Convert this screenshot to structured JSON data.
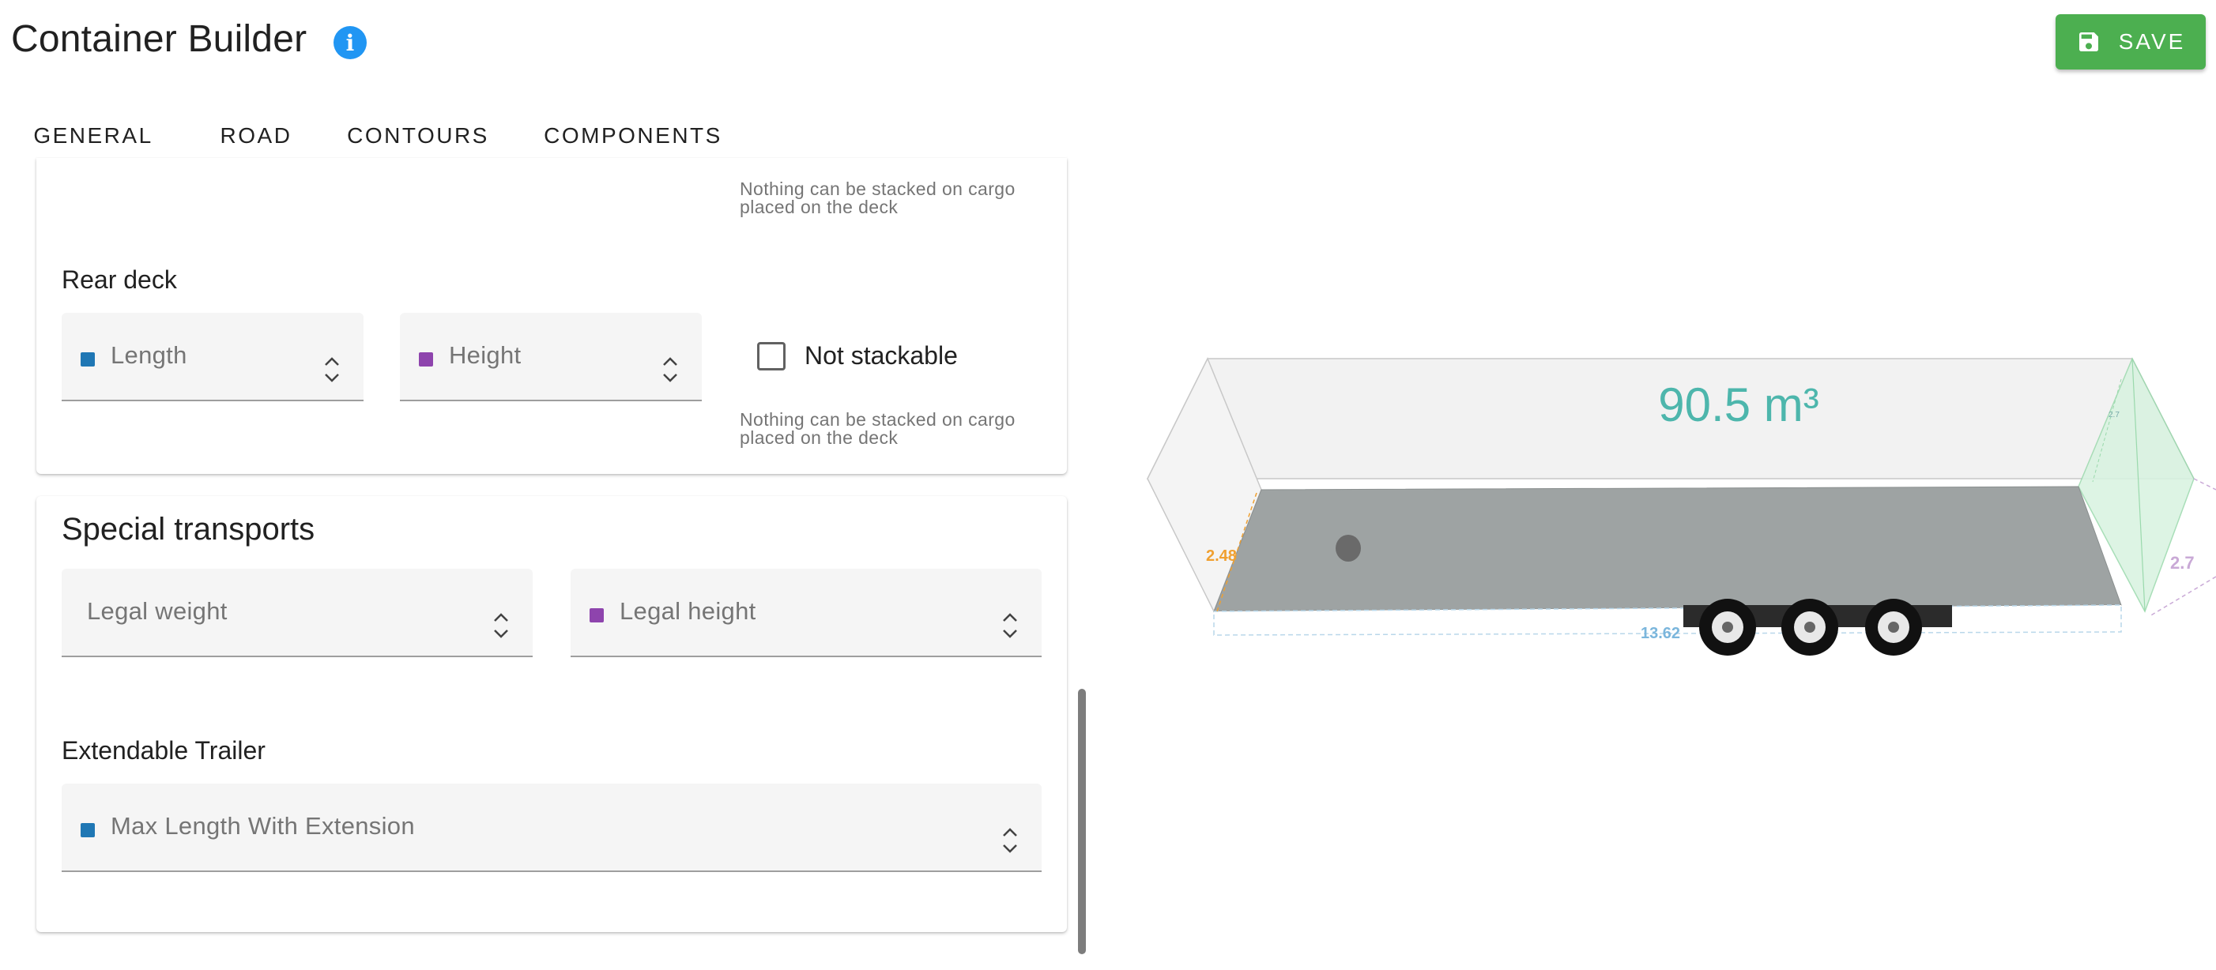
{
  "header": {
    "title": "Container Builder",
    "info_icon": "info-icon",
    "save_label": "SAVE",
    "save_icon": "floppy-disk-icon"
  },
  "tabs": [
    {
      "label": "GENERAL",
      "active": false
    },
    {
      "label": "ROAD",
      "active": true
    },
    {
      "label": "CONTOURS",
      "active": false
    },
    {
      "label": "COMPONENTS",
      "active": false
    }
  ],
  "colors": {
    "length_swatch": "#1f77b4",
    "height_swatch": "#8e44ad",
    "save_button": "#4caf50",
    "info_icon": "#2196f3",
    "volume_text": "#4db6ac"
  },
  "form": {
    "front_deck_hint": "Nothing can be stacked on cargo placed on the deck",
    "rear_deck": {
      "label": "Rear deck",
      "length_placeholder": "Length",
      "height_placeholder": "Height",
      "not_stackable_label": "Not stackable",
      "not_stackable_checked": false,
      "hint": "Nothing can be stacked on cargo placed on the deck"
    },
    "special_transports": {
      "heading": "Special transports",
      "legal_weight_placeholder": "Legal weight",
      "legal_height_placeholder": "Legal height"
    },
    "extendable_trailer": {
      "label": "Extendable Trailer",
      "max_length_placeholder": "Max Length With Extension"
    }
  },
  "viewer": {
    "volume": "90.5 m³",
    "dim_length": "13.62",
    "dim_width": "2.48",
    "dim_height": "2.7",
    "small_label": "2.7"
  }
}
